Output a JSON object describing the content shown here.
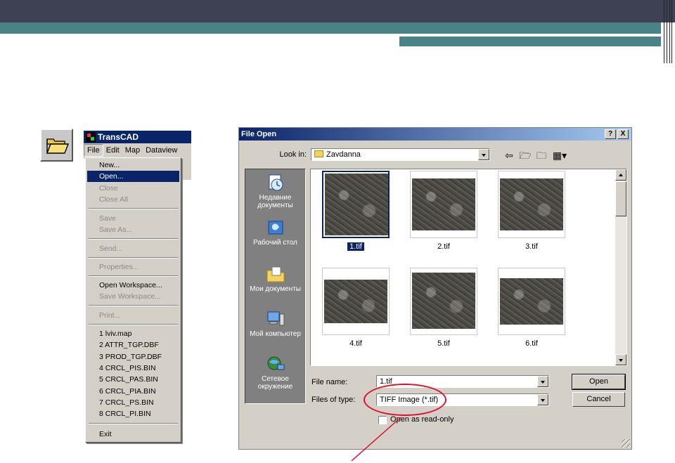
{
  "transcad": {
    "title": "TransCAD",
    "menubar": [
      "File",
      "Edit",
      "Map",
      "Dataview"
    ],
    "file_menu": [
      {
        "label": "New...",
        "state": "normal"
      },
      {
        "label": "Open...",
        "state": "selected"
      },
      {
        "label": "Close",
        "state": "disabled"
      },
      {
        "label": "Close All",
        "state": "disabled"
      },
      {
        "label": "Save",
        "state": "disabled"
      },
      {
        "label": "Save As...",
        "state": "disabled"
      },
      {
        "label": "Send...",
        "state": "disabled"
      },
      {
        "label": "Properties...",
        "state": "disabled"
      },
      {
        "label": "Open Workspace...",
        "state": "normal"
      },
      {
        "label": "Save Workspace...",
        "state": "disabled"
      },
      {
        "label": "Print...",
        "state": "disabled"
      },
      {
        "label": "1 lviv.map",
        "state": "normal"
      },
      {
        "label": "2 ATTR_TGP.DBF",
        "state": "normal"
      },
      {
        "label": "3 PROD_TGP.DBF",
        "state": "normal"
      },
      {
        "label": "4 CRCL_PIS.BIN",
        "state": "normal"
      },
      {
        "label": "5 CRCL_PAS.BIN",
        "state": "normal"
      },
      {
        "label": "6 CRCL_PIA.BIN",
        "state": "normal"
      },
      {
        "label": "7 CRCL_PS.BIN",
        "state": "normal"
      },
      {
        "label": "8 CRCL_PI.BIN",
        "state": "normal"
      },
      {
        "label": "Exit",
        "state": "normal"
      }
    ]
  },
  "dialog": {
    "title": "File Open",
    "title_buttons": [
      "?",
      "X"
    ],
    "look_in_label": "Look in:",
    "look_in_value": "Zavdanna",
    "toolbar_icons": [
      "back-arrow-icon",
      "up-folder-icon",
      "new-folder-icon",
      "view-menu-icon"
    ],
    "places": [
      {
        "label": "Недавние документы",
        "icon": "recent-documents-icon"
      },
      {
        "label": "Рабочий стол",
        "icon": "desktop-icon"
      },
      {
        "label": "Мои документы",
        "icon": "my-documents-icon"
      },
      {
        "label": "Мой компьютер",
        "icon": "my-computer-icon"
      },
      {
        "label": "Сетевое окружение",
        "icon": "network-icon"
      }
    ],
    "files": [
      "1.tif",
      "2.tif",
      "3.tif",
      "4.tif",
      "5.tif",
      "6.tif"
    ],
    "selected_file": "1.tif",
    "file_name_label": "File name:",
    "file_name_value": "1.tif",
    "files_of_type_label": "Files of type:",
    "files_of_type_value": "TIFF Image (*.tif)",
    "open_button": "Open",
    "cancel_button": "Cancel",
    "readonly_label": "Open as read-only",
    "readonly_checked": false
  },
  "colors": {
    "slide_dark": "#3e4153",
    "slide_teal": "#4a8387",
    "win_face": "#d4d0c8",
    "win_title": "#0a246a",
    "annotation_red": "#e0102a"
  }
}
